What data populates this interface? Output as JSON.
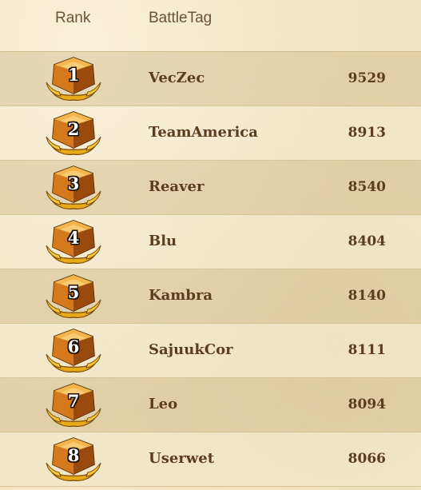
{
  "header": {
    "rank_label": "Rank",
    "battletag_label": "BattleTag"
  },
  "leaderboard": {
    "rows": [
      {
        "rank": "1",
        "battletag": "VecZec",
        "score": "9529"
      },
      {
        "rank": "2",
        "battletag": "TeamAmerica",
        "score": "8913"
      },
      {
        "rank": "3",
        "battletag": "Reaver",
        "score": "8540"
      },
      {
        "rank": "4",
        "battletag": "Blu",
        "score": "8404"
      },
      {
        "rank": "5",
        "battletag": "Kambra",
        "score": "8140"
      },
      {
        "rank": "6",
        "battletag": "SajuukCor",
        "score": "8111"
      },
      {
        "rank": "7",
        "battletag": "Leo",
        "score": "8094"
      },
      {
        "rank": "8",
        "battletag": "Userwet",
        "score": "8066"
      }
    ]
  },
  "icons": {
    "rank_badge": "legend-rank-badge-icon"
  },
  "colors": {
    "background": "#f1e4c3",
    "row_stripe": "#d9c596",
    "text": "#5c3d1f",
    "header_text": "#6a5238",
    "badge_gold": "#f0b41e",
    "badge_orange": "#c86414"
  }
}
